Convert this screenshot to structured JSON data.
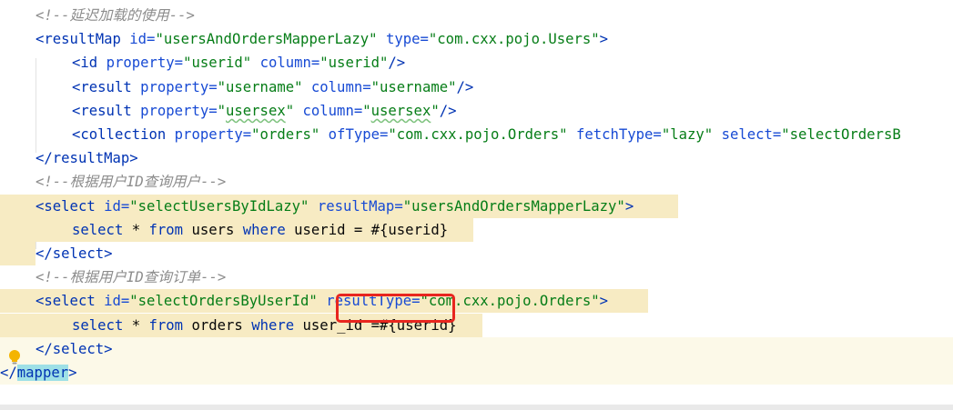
{
  "lines": [
    {
      "indent": 1,
      "tokens": [
        {
          "t": "comment",
          "v": "<!--延迟加载的使用-->"
        }
      ]
    },
    {
      "indent": 1,
      "tokens": [
        {
          "t": "tag",
          "v": "<resultMap"
        },
        {
          "t": "plain",
          "v": " "
        },
        {
          "t": "attr",
          "v": "id="
        },
        {
          "t": "val",
          "v": "\"usersAndOrdersMapperLazy\""
        },
        {
          "t": "plain",
          "v": " "
        },
        {
          "t": "attr",
          "v": "type="
        },
        {
          "t": "val",
          "v": "\"com.cxx.pojo.Users\""
        },
        {
          "t": "tag",
          "v": ">"
        }
      ]
    },
    {
      "indent": 2,
      "tokens": [
        {
          "t": "tag",
          "v": "<id"
        },
        {
          "t": "plain",
          "v": " "
        },
        {
          "t": "attr",
          "v": "property="
        },
        {
          "t": "val",
          "v": "\"userid\""
        },
        {
          "t": "plain",
          "v": " "
        },
        {
          "t": "attr",
          "v": "column="
        },
        {
          "t": "val",
          "v": "\"userid\""
        },
        {
          "t": "tag",
          "v": "/>"
        }
      ]
    },
    {
      "indent": 2,
      "tokens": [
        {
          "t": "tag",
          "v": "<result"
        },
        {
          "t": "plain",
          "v": " "
        },
        {
          "t": "attr",
          "v": "property="
        },
        {
          "t": "val",
          "v": "\"username\""
        },
        {
          "t": "plain",
          "v": " "
        },
        {
          "t": "attr",
          "v": "column="
        },
        {
          "t": "val",
          "v": "\"username\""
        },
        {
          "t": "tag",
          "v": "/>"
        }
      ]
    },
    {
      "indent": 2,
      "tokens": [
        {
          "t": "tag",
          "v": "<result"
        },
        {
          "t": "plain",
          "v": " "
        },
        {
          "t": "attr",
          "v": "property="
        },
        {
          "t": "val",
          "v": "\""
        },
        {
          "t": "valtypo",
          "v": "usersex"
        },
        {
          "t": "val",
          "v": "\""
        },
        {
          "t": "plain",
          "v": " "
        },
        {
          "t": "attr",
          "v": "column="
        },
        {
          "t": "val",
          "v": "\""
        },
        {
          "t": "valtypo",
          "v": "usersex"
        },
        {
          "t": "val",
          "v": "\""
        },
        {
          "t": "tag",
          "v": "/>"
        }
      ]
    },
    {
      "indent": 2,
      "tokens": [
        {
          "t": "tag",
          "v": "<collection"
        },
        {
          "t": "plain",
          "v": " "
        },
        {
          "t": "attr",
          "v": "property="
        },
        {
          "t": "val",
          "v": "\"orders\""
        },
        {
          "t": "plain",
          "v": " "
        },
        {
          "t": "attr",
          "v": "ofType="
        },
        {
          "t": "val",
          "v": "\"com.cxx.pojo.Orders\""
        },
        {
          "t": "plain",
          "v": " "
        },
        {
          "t": "attr",
          "v": "fetchType="
        },
        {
          "t": "val",
          "v": "\"lazy\""
        },
        {
          "t": "plain",
          "v": " "
        },
        {
          "t": "attr",
          "v": "select="
        },
        {
          "t": "val",
          "v": "\"selectOrdersB"
        }
      ]
    },
    {
      "indent": 1,
      "tokens": [
        {
          "t": "tag",
          "v": "</resultMap>"
        }
      ]
    },
    {
      "indent": 1,
      "tokens": [
        {
          "t": "comment",
          "v": "<!--根据用户ID查询用户-->"
        }
      ]
    },
    {
      "indent": 1,
      "tokens": [
        {
          "t": "tag",
          "v": "<select"
        },
        {
          "t": "plain",
          "v": " "
        },
        {
          "t": "attr",
          "v": "id="
        },
        {
          "t": "val",
          "v": "\"selectUsersByIdLazy\""
        },
        {
          "t": "plain",
          "v": " "
        },
        {
          "t": "attr",
          "v": "resultMap="
        },
        {
          "t": "val",
          "v": "\"usersAndOrdersMapperLazy\""
        },
        {
          "t": "tag",
          "v": ">"
        }
      ]
    },
    {
      "indent": 2,
      "tokens": [
        {
          "t": "sql",
          "v": "select"
        },
        {
          "t": "plain",
          "v": " * "
        },
        {
          "t": "sql",
          "v": "from"
        },
        {
          "t": "plain",
          "v": " users "
        },
        {
          "t": "sql",
          "v": "where"
        },
        {
          "t": "plain",
          "v": " userid = #{userid}"
        }
      ]
    },
    {
      "indent": 1,
      "tokens": [
        {
          "t": "tag",
          "v": "</select>"
        }
      ]
    },
    {
      "indent": 1,
      "tokens": [
        {
          "t": "comment",
          "v": "<!--根据用户ID查询订单-->"
        }
      ]
    },
    {
      "indent": 1,
      "tokens": [
        {
          "t": "tag",
          "v": "<select"
        },
        {
          "t": "plain",
          "v": " "
        },
        {
          "t": "attr",
          "v": "id="
        },
        {
          "t": "val",
          "v": "\"selectOrdersByUserId\""
        },
        {
          "t": "plain",
          "v": " "
        },
        {
          "t": "attr",
          "v": "resultType="
        },
        {
          "t": "val",
          "v": "\"com.cxx.pojo.Orders\""
        },
        {
          "t": "tag",
          "v": ">"
        }
      ]
    },
    {
      "indent": 2,
      "tokens": [
        {
          "t": "sql",
          "v": "select"
        },
        {
          "t": "plain",
          "v": " * "
        },
        {
          "t": "sql",
          "v": "from"
        },
        {
          "t": "plain",
          "v": " orders "
        },
        {
          "t": "sql",
          "v": "where"
        },
        {
          "t": "plain",
          "v": " user_id =#{userid}"
        }
      ]
    },
    {
      "indent": 1,
      "tokens": [
        {
          "t": "tag",
          "v": "</select>"
        }
      ]
    },
    {
      "indent": 0,
      "tokens": [
        {
          "t": "tag",
          "v": "</"
        },
        {
          "t": "taghl",
          "v": "mapper"
        },
        {
          "t": "tag",
          "v": ">"
        }
      ]
    }
  ],
  "colors": {
    "comment": "#8c8c8c",
    "tag": "#0033b3",
    "attribute": "#174ad4",
    "value": "#067d17",
    "line_highlight": "#f7ebc3",
    "annotation_box": "#e8261f"
  },
  "icons": {
    "gutter": "lightbulb-icon"
  }
}
